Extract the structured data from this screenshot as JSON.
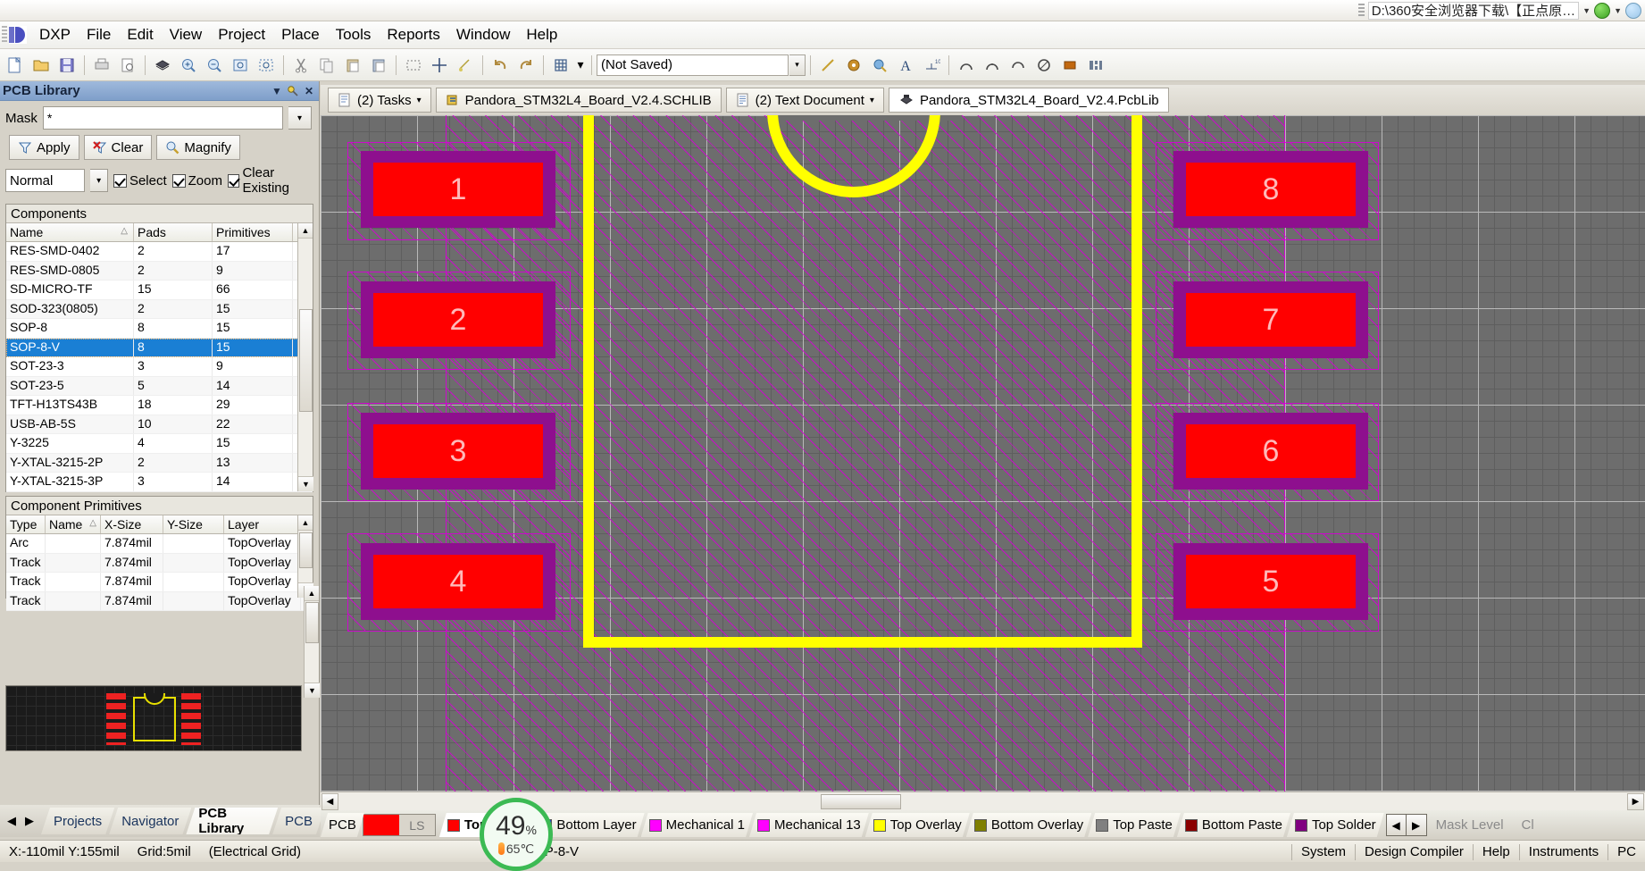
{
  "titlebar": {
    "path": "D:\\360安全浏览器下载\\【正点原…"
  },
  "menubar": {
    "items": [
      {
        "label": "DXP",
        "accel": "X"
      },
      {
        "label": "File",
        "accel": "F"
      },
      {
        "label": "Edit",
        "accel": "E"
      },
      {
        "label": "View",
        "accel": "V"
      },
      {
        "label": "Project",
        "accel": "c"
      },
      {
        "label": "Place",
        "accel": "P"
      },
      {
        "label": "Tools",
        "accel": "T"
      },
      {
        "label": "Reports",
        "accel": "R"
      },
      {
        "label": "Window",
        "accel": "W"
      },
      {
        "label": "Help",
        "accel": "H"
      }
    ]
  },
  "toolbar": {
    "doc_selector_value": "(Not Saved)"
  },
  "panel": {
    "title": "PCB Library",
    "mask_label": "Mask",
    "mask_value": "*",
    "buttons": {
      "apply": "Apply",
      "clear": "Clear",
      "magnify": "Magnify"
    },
    "select_mode": "Normal",
    "checkboxes": [
      {
        "label": "Select",
        "checked": true
      },
      {
        "label": "Zoom",
        "checked": true
      },
      {
        "label": "Clear Existing",
        "checked": true
      }
    ],
    "components": {
      "caption": "Components",
      "columns": [
        "Name",
        "Pads",
        "Primitives"
      ],
      "sort_column": "Name",
      "rows": [
        {
          "name": "RES-SMD-0402",
          "pads": "2",
          "primitives": "17",
          "selected": false
        },
        {
          "name": "RES-SMD-0805",
          "pads": "2",
          "primitives": "9",
          "selected": false
        },
        {
          "name": "SD-MICRO-TF",
          "pads": "15",
          "primitives": "66",
          "selected": false
        },
        {
          "name": "SOD-323(0805)",
          "pads": "2",
          "primitives": "15",
          "selected": false
        },
        {
          "name": "SOP-8",
          "pads": "8",
          "primitives": "15",
          "selected": false
        },
        {
          "name": "SOP-8-V",
          "pads": "8",
          "primitives": "15",
          "selected": true
        },
        {
          "name": "SOT-23-3",
          "pads": "3",
          "primitives": "9",
          "selected": false
        },
        {
          "name": "SOT-23-5",
          "pads": "5",
          "primitives": "14",
          "selected": false
        },
        {
          "name": "TFT-H13TS43B",
          "pads": "18",
          "primitives": "29",
          "selected": false
        },
        {
          "name": "USB-AB-5S",
          "pads": "10",
          "primitives": "22",
          "selected": false
        },
        {
          "name": "Y-3225",
          "pads": "4",
          "primitives": "15",
          "selected": false
        },
        {
          "name": "Y-XTAL-3215-2P",
          "pads": "2",
          "primitives": "13",
          "selected": false
        },
        {
          "name": "Y-XTAL-3215-3P",
          "pads": "3",
          "primitives": "14",
          "selected": false
        }
      ]
    },
    "primitives": {
      "caption": "Component Primitives",
      "columns": [
        "Type",
        "Name",
        "X-Size",
        "Y-Size",
        "Layer"
      ],
      "sort_column": "Name",
      "rows": [
        {
          "type": "Arc",
          "name": "",
          "xsize": "7.874mil",
          "ysize": "",
          "layer": "TopOverlay"
        },
        {
          "type": "Track",
          "name": "",
          "xsize": "7.874mil",
          "ysize": "",
          "layer": "TopOverlay"
        },
        {
          "type": "Track",
          "name": "",
          "xsize": "7.874mil",
          "ysize": "",
          "layer": "TopOverlay"
        },
        {
          "type": "Track",
          "name": "",
          "xsize": "7.874mil",
          "ysize": "",
          "layer": "TopOverlay"
        }
      ]
    }
  },
  "doc_tabs": [
    {
      "label": "(2) Tasks",
      "icon": "document-icon",
      "has_dropdown": true,
      "active": false
    },
    {
      "label": "Pandora_STM32L4_Board_V2.4.SCHLIB",
      "icon": "schlib-icon",
      "has_dropdown": false,
      "active": false
    },
    {
      "label": "(2) Text Document",
      "icon": "text-document-icon",
      "has_dropdown": true,
      "active": false
    },
    {
      "label": "Pandora_STM32L4_Board_V2.4.PcbLib",
      "icon": "pcblib-icon",
      "has_dropdown": false,
      "active": true
    }
  ],
  "left_tabs": [
    {
      "label": "Projects",
      "active": false
    },
    {
      "label": "Navigator",
      "active": false
    },
    {
      "label": "PCB Library",
      "active": true
    },
    {
      "label": "PCB",
      "active": false
    }
  ],
  "canvas": {
    "pads_left": [
      "1",
      "2",
      "3",
      "4"
    ],
    "pads_right": [
      "8",
      "7",
      "6",
      "5"
    ],
    "colors": {
      "pad_fill": "#ff0000",
      "pad_ring": "#8e0f8e",
      "outline": "#ffff00",
      "keepout": "#d600d6",
      "background": "#6d6d6d"
    }
  },
  "layerbar": {
    "pcb_label": "PCB",
    "ls_label": "LS",
    "ls_color": "#ff0000",
    "layers": [
      {
        "label": "Top Layer",
        "color": "#ff0000",
        "active": true
      },
      {
        "label": "Bottom Layer",
        "color": "#1f3fd0",
        "active": false
      },
      {
        "label": "Mechanical 1",
        "color": "#ff00ff",
        "active": false
      },
      {
        "label": "Mechanical 13",
        "color": "#ff00ff",
        "active": false
      },
      {
        "label": "Top Overlay",
        "color": "#ffff00",
        "active": false
      },
      {
        "label": "Bottom Overlay",
        "color": "#808000",
        "active": false
      },
      {
        "label": "Top Paste",
        "color": "#808080",
        "active": false
      },
      {
        "label": "Bottom Paste",
        "color": "#8b0000",
        "active": false
      },
      {
        "label": "Top Solder",
        "color": "#800080",
        "active": false
      }
    ],
    "mask_level": "Mask Level",
    "clear_label": "Cl"
  },
  "zoom_badge": {
    "zoom": "49",
    "zoom_unit": "%",
    "temperature": "65℃"
  },
  "statusbar": {
    "coords": "X:-110mil Y:155mil",
    "grid": "Grid:5mil",
    "grid_mode": "(Electrical Grid)",
    "component": "SOP-8-V",
    "right_items": [
      "System",
      "Design Compiler",
      "Help",
      "Instruments",
      "PC"
    ]
  }
}
